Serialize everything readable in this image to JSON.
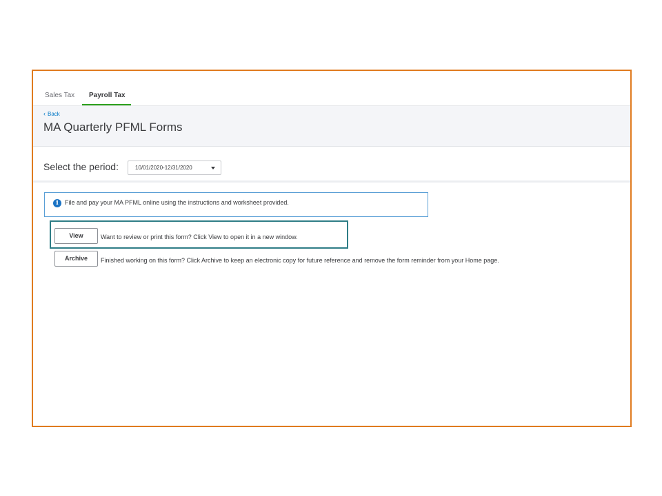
{
  "tabs": [
    {
      "label": "Sales Tax",
      "active": false
    },
    {
      "label": "Payroll Tax",
      "active": true
    }
  ],
  "header": {
    "back_label": "Back",
    "title": "MA Quarterly PFML Forms"
  },
  "period": {
    "label": "Select the period:",
    "selected": "10/01/2020-12/31/2020"
  },
  "info": {
    "icon": "info-icon",
    "text": "File and pay your MA PFML online using the instructions and worksheet provided."
  },
  "actions": {
    "view_label": "View",
    "view_desc": "Want to review or print this form? Click View to open it in a new window.",
    "archive_label": "Archive",
    "archive_desc": "Finished working on this form? Click Archive to keep an electronic copy for future reference and remove the form reminder from your Home page."
  },
  "colors": {
    "frame_border": "#e07b1f",
    "highlight_border": "#2e7d86",
    "active_tab": "#2ca01c",
    "link": "#0077c5",
    "info_border": "#5a9fd6"
  }
}
